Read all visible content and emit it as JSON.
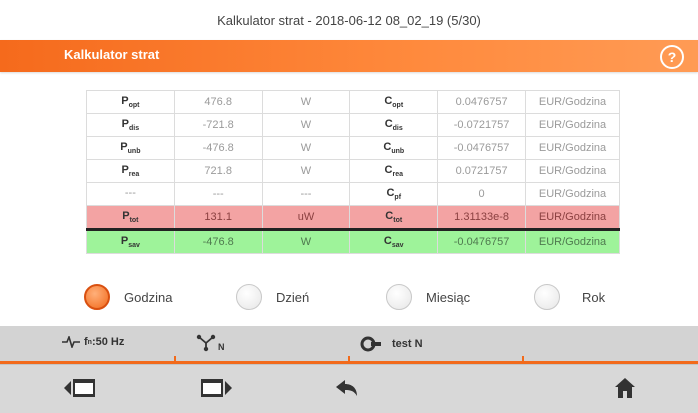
{
  "window": {
    "title": "Kalkulator strat - 2018-06-12 08_02_19 (5/30)"
  },
  "header": {
    "title": "Kalkulator strat",
    "help_label": "?"
  },
  "table": {
    "rows": [
      {
        "p_base": "P",
        "p_sub": "opt",
        "p_val": "476.8",
        "p_unit": "W",
        "c_base": "C",
        "c_sub": "opt",
        "c_val": "0.0476757",
        "c_unit": "EUR/Godzina"
      },
      {
        "p_base": "P",
        "p_sub": "dis",
        "p_val": "-721.8",
        "p_unit": "W",
        "c_base": "C",
        "c_sub": "dis",
        "c_val": "-0.0721757",
        "c_unit": "EUR/Godzina"
      },
      {
        "p_base": "P",
        "p_sub": "unb",
        "p_val": "-476.8",
        "p_unit": "W",
        "c_base": "C",
        "c_sub": "unb",
        "c_val": "-0.0476757",
        "c_unit": "EUR/Godzina"
      },
      {
        "p_base": "P",
        "p_sub": "rea",
        "p_val": "721.8",
        "p_unit": "W",
        "c_base": "C",
        "c_sub": "rea",
        "c_val": "0.0721757",
        "c_unit": "EUR/Godzina"
      },
      {
        "p_base": "---",
        "p_sub": "",
        "p_val": "---",
        "p_unit": "---",
        "c_base": "C",
        "c_sub": "pf",
        "c_val": "0",
        "c_unit": "EUR/Godzina"
      },
      {
        "p_base": "P",
        "p_sub": "tot",
        "p_val": "131.1",
        "p_unit": "uW",
        "c_base": "C",
        "c_sub": "tot",
        "c_val": "1.31133e-8",
        "c_unit": "EUR/Godzina"
      },
      {
        "p_base": "P",
        "p_sub": "sav",
        "p_val": "-476.8",
        "p_unit": "W",
        "c_base": "C",
        "c_sub": "sav",
        "c_val": "-0.0476757",
        "c_unit": "EUR/Godzina"
      }
    ]
  },
  "period": {
    "options": [
      "Godzina",
      "Dzień",
      "Miesiąc",
      "Rok"
    ],
    "selected": "Godzina"
  },
  "status": {
    "frequency_prefix": "f",
    "frequency_sub": "n",
    "frequency_value": ":50 Hz",
    "topology_sub": "N",
    "test_label": "test N"
  },
  "toolbar": {
    "icons": [
      "prev-screen-icon",
      "next-screen-icon",
      "back-icon",
      "home-icon"
    ]
  },
  "colors": {
    "accent": "#f26a1b",
    "total_row": "#f3a3a3",
    "savings_row": "#9ef39a"
  }
}
